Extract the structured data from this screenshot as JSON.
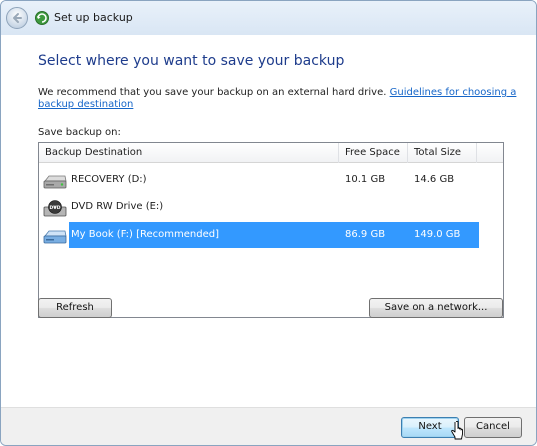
{
  "window": {
    "title": "Set up backup"
  },
  "main": {
    "heading": "Select where you want to save your backup",
    "description": "We recommend that you save your backup on an external hard drive. ",
    "guidelines_link": "Guidelines for choosing a backup destination",
    "save_label": "Save backup on:"
  },
  "table": {
    "columns": [
      "Backup Destination",
      "Free Space",
      "Total Size"
    ],
    "rows": [
      {
        "name": "RECOVERY (D:)",
        "free": "10.1 GB",
        "total": "14.6 GB",
        "icon": "hard-drive-icon",
        "selected": false
      },
      {
        "name": "DVD RW Drive (E:)",
        "free": "",
        "total": "",
        "icon": "dvd-drive-icon",
        "selected": false
      },
      {
        "name": "My Book (F:) [Recommended]",
        "free": "86.9 GB",
        "total": "149.0 GB",
        "icon": "external-drive-icon",
        "selected": true
      }
    ]
  },
  "buttons": {
    "refresh": "Refresh",
    "save_network": "Save on a network...",
    "next": "Next",
    "cancel": "Cancel"
  },
  "colors": {
    "heading": "#1e3c8c",
    "link": "#1565c8",
    "selection": "#3399ff"
  }
}
